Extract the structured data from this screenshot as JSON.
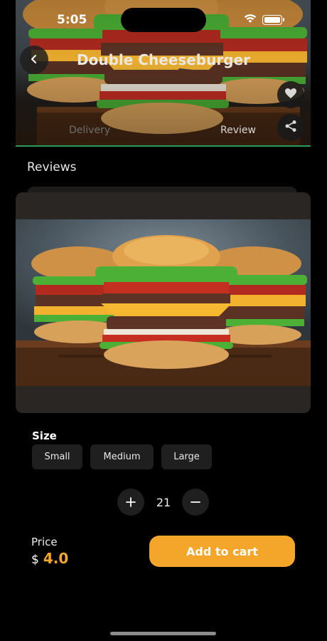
{
  "status_bar": {
    "time": "5:05"
  },
  "header": {
    "title": "Double Cheeseburger",
    "tabs": [
      {
        "label": "Delivery",
        "active": false
      },
      {
        "label": "Review",
        "active": true
      }
    ]
  },
  "reviews": {
    "heading": "Reviews"
  },
  "size": {
    "label": "Size",
    "options": [
      "Small",
      "Medium",
      "Large"
    ]
  },
  "quantity": {
    "value": "21"
  },
  "price": {
    "label": "Price",
    "currency": "$",
    "value": "4.0"
  },
  "cart": {
    "button_label": "Add to cart"
  },
  "colors": {
    "accent": "#f4a62a",
    "background": "#000000",
    "card": "#2a2624",
    "chip": "#1f1f1f",
    "tab_underline": "#2a9a55"
  },
  "icons": {
    "back": "chevron-left-icon",
    "favorite": "heart-icon",
    "share": "share-icon",
    "decrease": "plus-icon",
    "increase": "minus-icon",
    "wifi": "wifi-icon",
    "battery": "battery-icon"
  }
}
